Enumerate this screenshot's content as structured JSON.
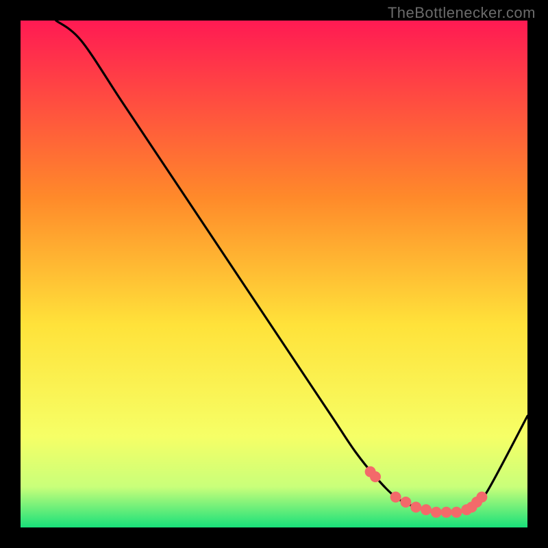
{
  "watermark": "TheBottlenecker.com",
  "gradient": {
    "top": "#ff1a53",
    "mid1": "#ff8a2a",
    "mid2": "#ffe23a",
    "mid3": "#f6ff66",
    "mid4": "#c9ff7a",
    "bottom": "#18e07a"
  },
  "chart_data": {
    "type": "line",
    "title": "",
    "xlabel": "",
    "ylabel": "",
    "xlim": [
      0,
      100
    ],
    "ylim": [
      0,
      100
    ],
    "series": [
      {
        "name": "bottleneck-curve",
        "x": [
          7,
          12,
          20,
          30,
          40,
          50,
          58,
          62,
          66,
          70,
          74,
          78,
          82,
          86,
          89,
          92,
          100
        ],
        "values": [
          100,
          96,
          84,
          69,
          54,
          39,
          27,
          21,
          15,
          10,
          6,
          4,
          3,
          3,
          4,
          7,
          22
        ]
      }
    ],
    "markers": {
      "name": "highlight-dots",
      "color": "#f36a6a",
      "x": [
        69,
        70,
        74,
        76,
        78,
        80,
        82,
        84,
        86,
        88,
        89,
        90,
        91
      ],
      "values": [
        11,
        10,
        6,
        5,
        4,
        3.5,
        3,
        3,
        3,
        3.5,
        4,
        5,
        6
      ]
    }
  }
}
